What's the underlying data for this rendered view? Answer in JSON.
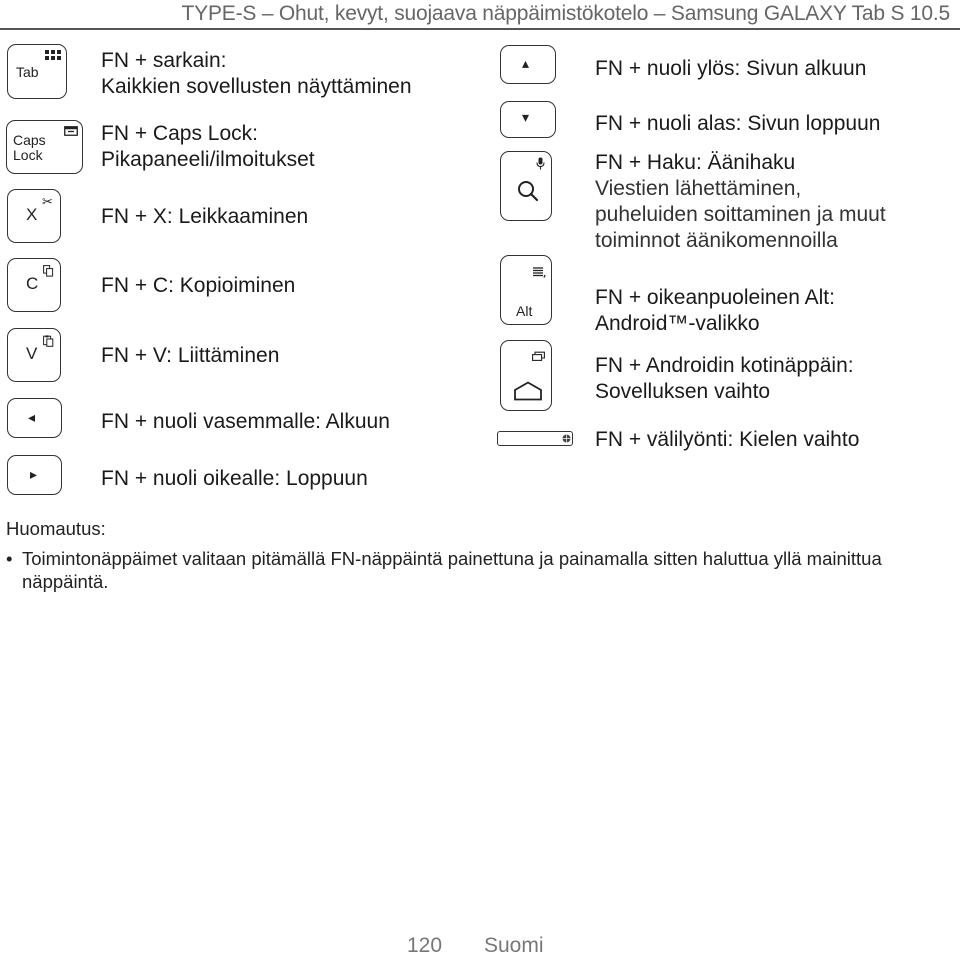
{
  "header": {
    "title": "TYPE-S – Ohut, kevyt, suojaava näppäimistökotelo – Samsung GALAXY Tab S 10.5"
  },
  "left_column": [
    {
      "key_label": "Tab",
      "icon": "apps-grid-icon",
      "line1": "FN + sarkain:",
      "line2": "Kaikkien sovellusten näyttäminen"
    },
    {
      "key_label_1": "Caps",
      "key_label_2": "Lock",
      "icon": "notification-panel-icon",
      "line1": "FN + Caps Lock:",
      "line2": "Pikapaneeli/ilmoitukset"
    },
    {
      "key_label": "X",
      "icon": "scissors-icon",
      "line1": "FN + X: Leikkaaminen"
    },
    {
      "key_label": "C",
      "icon": "copy-icon",
      "line1": "FN + C: Kopioiminen"
    },
    {
      "key_label": "V",
      "icon": "paste-icon",
      "line1": "FN + V: Liittäminen"
    },
    {
      "key_label": "◂",
      "icon": "arrow-left-icon",
      "line1": "FN + nuoli vasemmalle: Alkuun"
    },
    {
      "key_label": "▸",
      "icon": "arrow-right-icon",
      "line1": "FN + nuoli oikealle: Loppuun"
    }
  ],
  "right_column": [
    {
      "key_label": "▴",
      "icon": "arrow-up-icon",
      "line1": "FN + nuoli ylös: Sivun alkuun"
    },
    {
      "key_label": "▾",
      "icon": "arrow-down-icon",
      "line1": "FN + nuoli alas: Sivun loppuun"
    },
    {
      "icon": "search-icon",
      "secondary_icon": "microphone-icon",
      "line1": "FN + Haku: Äänihaku",
      "detail_1": "Viestien lähettäminen,",
      "detail_2": "puheluiden soittaminen ja muut",
      "detail_3": "toiminnot äänikomennoilla"
    },
    {
      "key_label": "Alt",
      "icon": "menu-icon",
      "line1": "FN + oikeanpuoleinen Alt:",
      "line2": "Android™-valikko"
    },
    {
      "icon": "home-icon",
      "secondary_icon": "recent-apps-icon",
      "line1": "FN + Androidin kotinäppäin:",
      "line2": "Sovelluksen vaihto"
    },
    {
      "icon": "globe-icon",
      "line1": "FN + välilyönti: Kielen vaihto"
    }
  ],
  "note": {
    "heading": "Huomautus:",
    "bullet": "•",
    "text": "Toimintonäppäimet valitaan pitämällä FN-näppäintä painettuna ja painamalla sitten haluttua yllä mainittua näppäintä."
  },
  "footer": {
    "page_number": "120",
    "language": "Suomi"
  }
}
